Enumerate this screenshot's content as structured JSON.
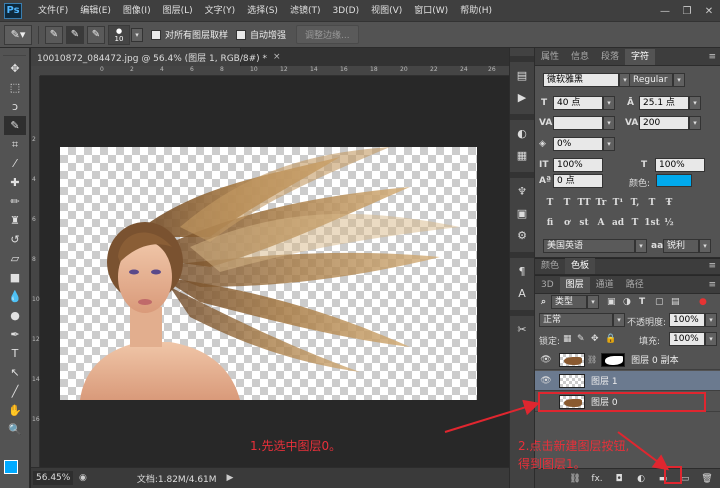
{
  "app": {
    "logo": "Ps",
    "menus": [
      "文件(F)",
      "编辑(E)",
      "图像(I)",
      "图层(L)",
      "文字(Y)",
      "选择(S)",
      "滤镜(T)",
      "3D(D)",
      "视图(V)",
      "窗口(W)",
      "帮助(H)"
    ]
  },
  "options": {
    "brush_size": "10",
    "sample_all_layers": "对所有图层取样",
    "auto_enhance": "自动增强",
    "refine_edge": "调整边缘..."
  },
  "document": {
    "tab_title": "10010872_084472.jpg @ 56.4% (图层 1, RGB/8#) *",
    "close_glyph": "×",
    "ruler_top": [
      "0",
      "2",
      "4",
      "6",
      "8",
      "10",
      "12",
      "14",
      "16",
      "18",
      "20",
      "22",
      "24",
      "26",
      "28"
    ],
    "ruler_left": [
      "2",
      "4",
      "6",
      "8",
      "10",
      "12",
      "14",
      "16",
      "18",
      "20"
    ]
  },
  "status": {
    "zoom": "56.45%",
    "doc_info": "文档:1.82M/4.61M",
    "arrow": "▶"
  },
  "character_panel": {
    "tabs": [
      "属性",
      "信息",
      "段落",
      "字符"
    ],
    "font_family": "微软雅黑",
    "font_style": "Regular",
    "font_size": "40 点",
    "leading": "25.1 点",
    "tracking": "200",
    "scale_pct": "0%",
    "vscale": "100%",
    "hscale": "100%",
    "baseline": "0 点",
    "color_label": "颜色:",
    "language": "美国英语",
    "aa_label": "aa",
    "antialias": "锐利",
    "style_buttons": [
      "T",
      "T",
      "TT",
      "Tr",
      "T¹",
      "T,",
      "T",
      "Ŧ"
    ],
    "ot_buttons": [
      "fi",
      "ơ",
      "st",
      "A",
      "ad",
      "T",
      "1st",
      "½"
    ],
    "text_color": "#00aaee"
  },
  "swatch_panel": {
    "tabs": [
      "颜色",
      "色板"
    ]
  },
  "layers_panel": {
    "tabs": [
      "3D",
      "图层",
      "通道",
      "路径"
    ],
    "filter_kind": "类型",
    "blend_mode": "正常",
    "opacity_label": "不透明度:",
    "opacity": "100%",
    "lock_label": "锁定:",
    "fill_label": "填充:",
    "fill": "100%",
    "layers": [
      {
        "name": "图层 0 副本",
        "visible": true,
        "has_mask": true,
        "selected": false
      },
      {
        "name": "图层 1",
        "visible": true,
        "has_mask": false,
        "selected": true
      },
      {
        "name": "图层 0",
        "visible": false,
        "has_mask": false,
        "selected": false
      }
    ],
    "fx_label": "fx."
  },
  "annotations": {
    "step1": "1.先选中图层0。",
    "step2_line1": "2.点击新建图层按钮,",
    "step2_line2": "得到图层1。",
    "color": "#e8303a"
  }
}
